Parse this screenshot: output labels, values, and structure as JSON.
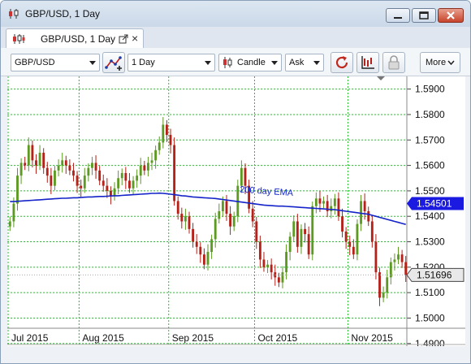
{
  "window": {
    "title": "GBP/USD, 1 Day"
  },
  "tab": {
    "label": "GBP/USD, 1 Day"
  },
  "toolbar": {
    "symbol": "GBP/USD",
    "timeframe": "1 Day",
    "chart_type": "Candle",
    "price_side": "Ask",
    "more_label": "More"
  },
  "colors": {
    "up": "#5c9a22",
    "down": "#b52018",
    "ema": "#1524c8",
    "grid": "#22c02a"
  },
  "icons": [
    "candles-icon",
    "popout-icon",
    "close-tab-icon",
    "indicator-icon",
    "candle-type-icon",
    "refresh-icon",
    "drawing-icon",
    "lock-icon"
  ],
  "chart": {
    "ema_label": "200 day EMA",
    "ema_value": "1.54501",
    "last_price": "1.51696",
    "y_ticks": [
      "1.5900",
      "1.5800",
      "1.5700",
      "1.5600",
      "1.5500",
      "1.5400",
      "1.5300",
      "1.5200",
      "1.5100",
      "1.5000",
      "1.4900"
    ],
    "x_ticks": [
      "Jul 2015",
      "Aug 2015",
      "Sep 2015",
      "Oct 2015",
      "Nov 2015"
    ],
    "year_label": "2015"
  },
  "chart_data": {
    "type": "candlestick",
    "x_ticks": [
      "Jul 2015",
      "Aug 2015",
      "Sep 2015",
      "Oct 2015",
      "Nov 2015"
    ],
    "y_ticks": [
      1.49,
      1.5,
      1.51,
      1.52,
      1.53,
      1.54,
      1.55,
      1.56,
      1.57,
      1.58,
      1.59
    ],
    "ylim": [
      1.496,
      1.595
    ],
    "close": [
      1.538,
      1.545,
      1.556,
      1.561,
      1.56,
      1.568,
      1.562,
      1.56,
      1.565,
      1.559,
      1.556,
      1.552,
      1.558,
      1.56,
      1.562,
      1.56,
      1.558,
      1.556,
      1.552,
      1.551,
      1.556,
      1.559,
      1.561,
      1.558,
      1.554,
      1.552,
      1.55,
      1.548,
      1.551,
      1.555,
      1.557,
      1.554,
      1.551,
      1.554,
      1.556,
      1.56,
      1.558,
      1.561,
      1.562,
      1.566,
      1.569,
      1.576,
      1.572,
      1.568,
      1.546,
      1.541,
      1.538,
      1.54,
      1.535,
      1.53,
      1.528,
      1.525,
      1.521,
      1.526,
      1.531,
      1.539,
      1.542,
      1.546,
      1.541,
      1.536,
      1.54,
      1.552,
      1.559,
      1.552,
      1.543,
      1.538,
      1.53,
      1.523,
      1.52,
      1.521,
      1.518,
      1.516,
      1.514,
      1.518,
      1.526,
      1.532,
      1.538,
      1.528,
      1.535,
      1.533,
      1.525,
      1.544,
      1.547,
      1.545,
      1.546,
      1.542,
      1.544,
      1.547,
      1.54,
      1.534,
      1.53,
      1.528,
      1.525,
      1.537,
      1.546,
      1.542,
      1.538,
      1.53,
      1.518,
      1.508,
      1.51,
      1.516,
      1.522,
      1.523,
      1.525,
      1.522,
      1.517
    ],
    "ema": [
      1.5458,
      1.5458,
      1.5459,
      1.546,
      1.5461,
      1.5462,
      1.5463,
      1.5464,
      1.5465,
      1.5466,
      1.5467,
      1.5468,
      1.5469,
      1.547,
      1.5471,
      1.5471,
      1.5472,
      1.5473,
      1.5473,
      1.5474,
      1.5475,
      1.5476,
      1.5476,
      1.5477,
      1.5478,
      1.5478,
      1.5479,
      1.548,
      1.5481,
      1.5481,
      1.5482,
      1.5483,
      1.5484,
      1.5485,
      1.5486,
      1.5487,
      1.5488,
      1.5489,
      1.549,
      1.549,
      1.5491,
      1.549,
      1.5489,
      1.5487,
      1.5485,
      1.5483,
      1.5481,
      1.548,
      1.5478,
      1.5476,
      1.5475,
      1.5474,
      1.5473,
      1.5472,
      1.5471,
      1.547,
      1.5468,
      1.5466,
      1.5464,
      1.5462,
      1.546,
      1.5458,
      1.5456,
      1.5454,
      1.5452,
      1.545,
      1.5448,
      1.5446,
      1.5444,
      1.5443,
      1.5442,
      1.5441,
      1.544,
      1.544,
      1.5439,
      1.5438,
      1.5437,
      1.5436,
      1.5435,
      1.5434,
      1.5433,
      1.5432,
      1.5431,
      1.543,
      1.5429,
      1.5428,
      1.5427,
      1.5426,
      1.5424,
      1.5422,
      1.542,
      1.5418,
      1.5416,
      1.5414,
      1.5412,
      1.541,
      1.5408,
      1.5404,
      1.54,
      1.5396,
      1.5392,
      1.5388,
      1.5384,
      1.538,
      1.5376,
      1.5372,
      1.5368
    ],
    "series": [
      {
        "name": "200 day EMA"
      }
    ],
    "last_price": 1.51696,
    "ema_last": 1.54501
  }
}
